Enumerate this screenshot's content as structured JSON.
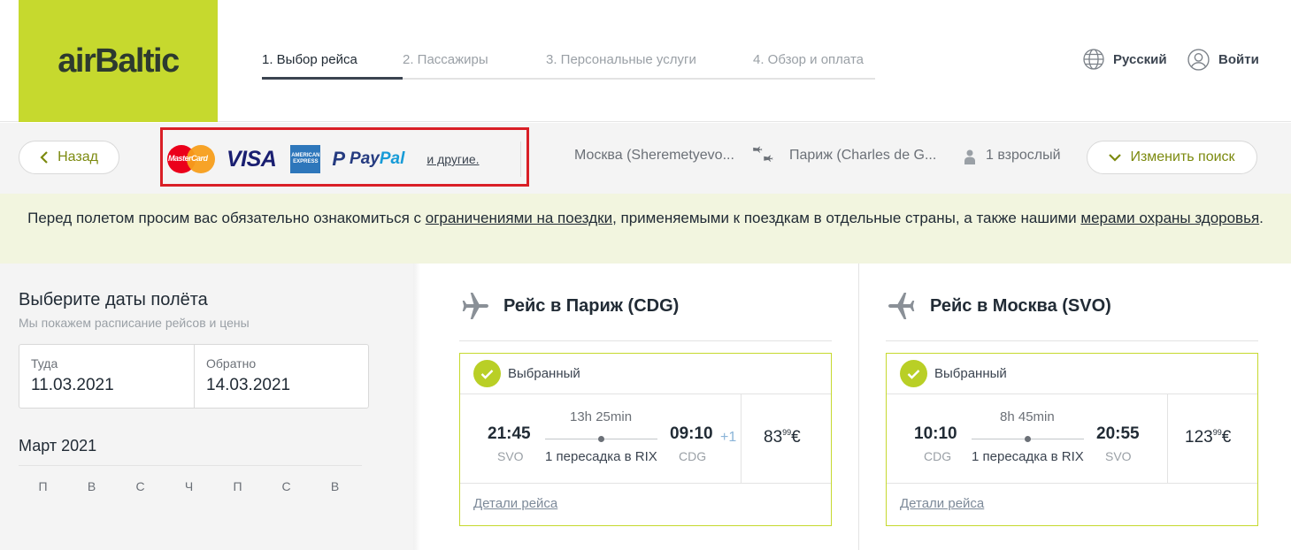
{
  "brand": {
    "name": "airBaltic",
    "color": "#c6d92e"
  },
  "steps": [
    {
      "label": "1. Выбор рейса",
      "active": true
    },
    {
      "label": "2. Пассажиры",
      "active": false
    },
    {
      "label": "3. Персональные услуги",
      "active": false
    },
    {
      "label": "4. Обзор и оплата",
      "active": false
    }
  ],
  "header": {
    "language_label": "Русский",
    "login_label": "Войти"
  },
  "search_bar": {
    "back_label": "Назад",
    "payment": {
      "mastercard": "MasterCard",
      "visa": "VISA",
      "amex": "AMERICAN EXPRESS",
      "paypal_p": "P",
      "paypal_pay": "Pay",
      "paypal_pal": "Pal",
      "others_label": "и другие."
    },
    "from": "Москва (Sheremetyevo...",
    "to": "Париж (Charles de G...",
    "passengers": "1 взрослый",
    "change_label": "Изменить поиск"
  },
  "notice": {
    "part1": "Перед полетом просим вас обязательно ознакомиться с ",
    "link1": "ограничениями на поездки",
    "part2": ", применяемыми к поездкам в отдельные страны, а также нашими ",
    "link2": "мерами охраны здоровья",
    "part3": "."
  },
  "date_panel": {
    "title": "Выберите даты полёта",
    "subtitle": "Мы покажем расписание рейсов и цены",
    "departure_label": "Туда",
    "departure_value": "11.03.2021",
    "return_label": "Обратно",
    "return_value": "14.03.2021",
    "month": "Март 2021",
    "weekdays": [
      "П",
      "В",
      "С",
      "Ч",
      "П",
      "С",
      "В"
    ]
  },
  "flights": [
    {
      "title": "Рейс в Париж (CDG)",
      "selected_label": "Выбранный",
      "dep_time": "21:45",
      "dep_code": "SVO",
      "duration": "13h 25min",
      "stops": "1 пересадка в RIX",
      "arr_time": "09:10",
      "arr_code": "CDG",
      "day_offset": "+1",
      "price_main": "83",
      "price_cents": "99",
      "currency": "€",
      "details_label": "Детали рейса"
    },
    {
      "title": "Рейс в Москва (SVO)",
      "selected_label": "Выбранный",
      "dep_time": "10:10",
      "dep_code": "CDG",
      "duration": "8h 45min",
      "stops": "1 пересадка в RIX",
      "arr_time": "20:55",
      "arr_code": "SVO",
      "price_main": "123",
      "price_cents": "99",
      "currency": "€",
      "details_label": "Детали рейса"
    }
  ],
  "icons": [
    "globe-icon",
    "user-icon",
    "chevron-left-icon",
    "chevron-down-icon",
    "plane-icon",
    "route-planes-icon",
    "person-icon",
    "check-icon"
  ]
}
